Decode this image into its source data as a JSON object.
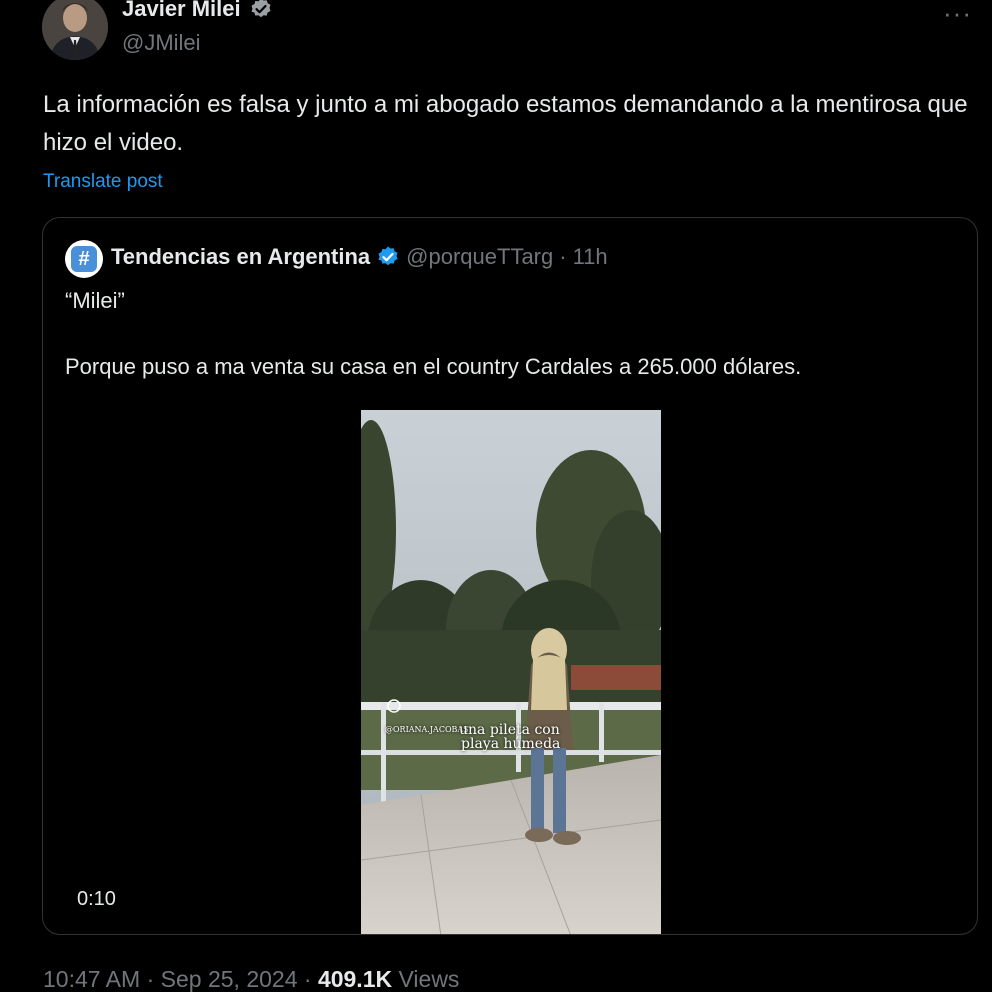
{
  "author": {
    "display_name": "Javier Milei",
    "handle": "@JMilei",
    "verified": true,
    "avatar_icon": "user-avatar"
  },
  "tweet": {
    "text": "La información es falsa y junto a mi abogado estamos demandando a la mentirosa que hizo el video.",
    "translate_label": "Translate post",
    "more_icon": "more-options-icon"
  },
  "quoted": {
    "display_name": "Tendencias en Argentina",
    "handle": "@porqueTTarg",
    "separator": "·",
    "time": "11h",
    "avatar_icon": "hashtag-icon",
    "line1": "“Milei”",
    "line2": "Porque puso a ma venta su casa en el country Cardales a 265.000 dólares.",
    "video": {
      "duration": "0:10",
      "overlay_handle": "@ORIANA.JACOBAS",
      "overlay_line1": "una pileta con",
      "overlay_line2": "playa húmeda"
    }
  },
  "meta": {
    "time": "10:47 AM",
    "separator": "·",
    "date": "Sep 25, 2024",
    "views": "409.1K",
    "views_label": "Views"
  },
  "colors": {
    "background": "#000000",
    "text": "#e7e9ea",
    "muted": "#71767b",
    "link": "#1d9bf0",
    "border": "#2f3336"
  }
}
